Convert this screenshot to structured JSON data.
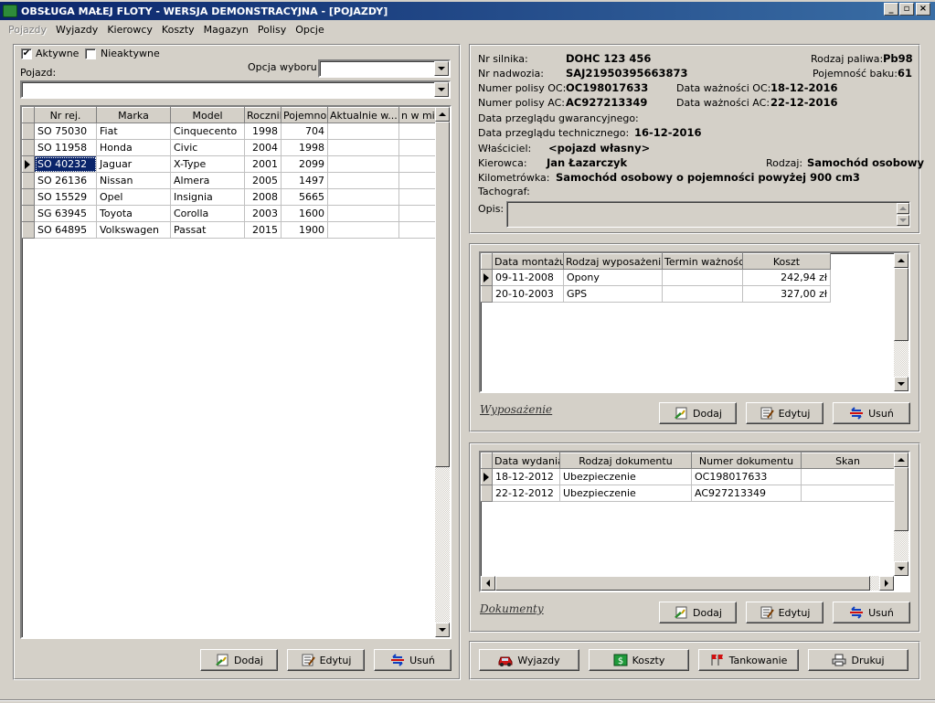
{
  "window": {
    "title": "OBSŁUGA MAŁEJ FLOTY - WERSJA DEMONSTRACYJNA - [POJAZDY]"
  },
  "menu": [
    "Pojazdy",
    "Wyjazdy",
    "Kierowcy",
    "Koszty",
    "Magazyn",
    "Polisy",
    "Opcje"
  ],
  "filters": {
    "active_label": "Aktywne",
    "active_checked": true,
    "inactive_label": "Nieaktywne",
    "inactive_checked": false,
    "vehicle_label": "Pojazd:",
    "option_label": "Opcja wyboru:",
    "option_value": "",
    "vehicle_value": ""
  },
  "vehicles": {
    "columns": [
      "Nr rej.",
      "Marka",
      "Model",
      "Rocznik",
      "Pojemność",
      "Aktualnie w...",
      "n w mie"
    ],
    "rows": [
      [
        "SO 75030",
        "Fiat",
        "Cinquecento",
        "1998",
        "704"
      ],
      [
        "SO 11958",
        "Honda",
        "Civic",
        "2004",
        "1998"
      ],
      [
        "SO 40232",
        "Jaguar",
        "X-Type",
        "2001",
        "2099"
      ],
      [
        "SO 26136",
        "Nissan",
        "Almera",
        "2005",
        "1497"
      ],
      [
        "SO 15529",
        "Opel",
        "Insignia",
        "2008",
        "5665"
      ],
      [
        "SG 63945",
        "Toyota",
        "Corolla",
        "2003",
        "1600"
      ],
      [
        "SO 64895",
        "Volkswagen",
        "Passat",
        "2015",
        "1900"
      ]
    ],
    "selected_row": 2
  },
  "left_buttons": {
    "add": "Dodaj",
    "edit": "Edytuj",
    "delete": "Usuń"
  },
  "details": {
    "engine_label": "Nr silnika:",
    "engine": "DOHC 123 456",
    "fuel_label": "Rodzaj paliwa:",
    "fuel": "Pb98",
    "body_label": "Nr nadwozia:",
    "body": "SAJ21950395663873",
    "tank_label": "Pojemność baku:",
    "tank": "61",
    "oc_label": "Numer polisy OC:",
    "oc": "OC198017633",
    "oc_date_label": "Data ważności OC:",
    "oc_date": "18-12-2016",
    "ac_label": "Numer polisy AC:",
    "ac": "AC927213349",
    "ac_date_label": "Data ważności AC:",
    "ac_date": "22-12-2016",
    "warranty_label": "Data przeglądu gwarancyjnego:",
    "tech_label": "Data przeglądu technicznego:",
    "tech": "16-12-2016",
    "owner_label": "Właściciel:",
    "owner": "<pojazd własny>",
    "driver_label": "Kierowca:",
    "driver": "Jan Łazarczyk",
    "kind_label": "Rodzaj:",
    "kind": "Samochód osobowy",
    "km_label": "Kilometrówka:",
    "km": "Samochód osobowy o pojemności powyżej 900 cm3",
    "tacho_label": "Tachograf:",
    "desc_label": "Opis:"
  },
  "equipment": {
    "section": "Wyposażenie",
    "columns": [
      "Data montażu",
      "Rodzaj wyposażenia",
      "Termin ważności",
      "Koszt"
    ],
    "rows": [
      [
        "09-11-2008",
        "Opony",
        "",
        "242,94 zł"
      ],
      [
        "20-10-2003",
        "GPS",
        "",
        "327,00 zł"
      ]
    ],
    "buttons": {
      "add": "Dodaj",
      "edit": "Edytuj",
      "delete": "Usuń"
    }
  },
  "documents": {
    "section": "Dokumenty",
    "columns": [
      "Data wydania",
      "Rodzaj dokumentu",
      "Numer dokumentu",
      "Skan"
    ],
    "rows": [
      [
        "18-12-2012",
        "Ubezpieczenie",
        "OC198017633",
        ""
      ],
      [
        "22-12-2012",
        "Ubezpieczenie",
        "AC927213349",
        ""
      ]
    ],
    "buttons": {
      "add": "Dodaj",
      "edit": "Edytuj",
      "delete": "Usuń"
    }
  },
  "bottom_buttons": {
    "trips": "Wyjazdy",
    "costs": "Koszty",
    "fuel": "Tankowanie",
    "print": "Drukuj"
  },
  "colors": {
    "title_start": "#0a246a",
    "title_end": "#3a6ea5",
    "face": "#d4d0c8",
    "selection": "#0a246a"
  }
}
